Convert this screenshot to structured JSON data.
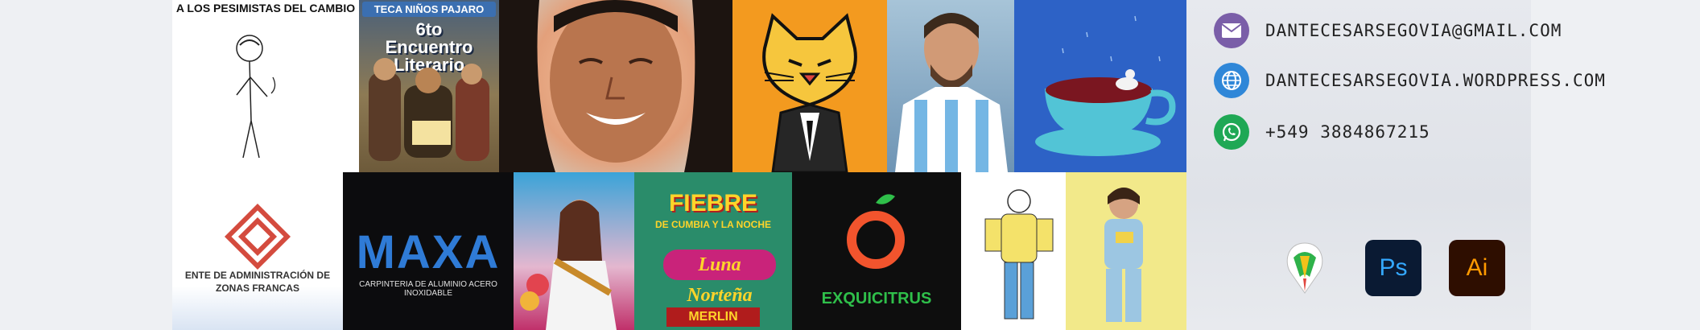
{
  "artworks": {
    "pesimistas": {
      "caption": "A LOS PESIMISTAS DEL CAMBIO"
    },
    "encuentro": {
      "title_top": "TECA NIÑOS PAJARO",
      "title_main": "6to Encuentro Literario"
    },
    "zonas_francas": {
      "caption": "ENTE DE ADMINISTRACIÓN DE ZONAS FRANCAS"
    },
    "maxa": {
      "logo": "MAXA",
      "tagline": "CARPINTERIA DE ALUMINIO ACERO INOXIDABLE"
    },
    "fiebre": {
      "title": "FIEBRE",
      "subtitle": "DE CUMBIA Y LA NOCHE",
      "band": "Luna Norteña",
      "act": "MERLIN"
    },
    "exquicitrus": {
      "name": "EXQUICITRUS"
    }
  },
  "contact": {
    "email": "DANTECESARSEGOVIA@GMAIL.COM",
    "website": "DANTECESARSEGOVIA.WORDPRESS.COM",
    "phone": "+549 3884867215"
  },
  "tools": [
    {
      "name": "CorelDRAW",
      "label": ""
    },
    {
      "name": "Photoshop",
      "label": "Ps"
    },
    {
      "name": "Illustrator",
      "label": "Ai"
    }
  ],
  "colors": {
    "email_icon": "#7a5ea8",
    "web_icon": "#2f87d8",
    "whatsapp_icon": "#1fa855",
    "ps_bg": "#0a1a33",
    "ps_fg": "#34a8ff",
    "ai_bg": "#2e0e00",
    "ai_fg": "#ff9a00"
  }
}
